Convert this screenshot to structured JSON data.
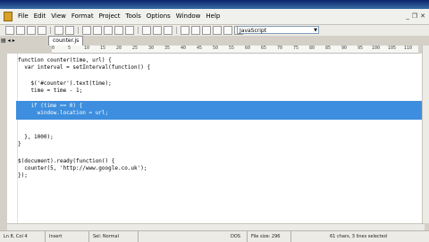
{
  "menu": [
    "File",
    "Edit",
    "View",
    "Format",
    "Project",
    "Tools",
    "Options",
    "Window",
    "Help"
  ],
  "language_select": "JavaScript",
  "tab": {
    "label": "counter.js"
  },
  "ruler_marks": [
    "0",
    "5",
    "10",
    "15",
    "20",
    "25",
    "30",
    "35",
    "40",
    "45",
    "50",
    "55",
    "60",
    "65",
    "70",
    "75",
    "80",
    "85",
    "90",
    "95",
    "100",
    "105",
    "110"
  ],
  "code": [
    "function counter(time, url) {",
    "  var interval = setInterval(function() {",
    "",
    "    $('#counter').text(time);",
    "    time = time - 1;",
    "",
    "    if (time == 0) {",
    "      window.location = url;",
    "",
    "",
    "  }, 1000);",
    "}",
    "",
    "$(document).ready(function() {",
    "  counter(5, 'http://www.google.co.uk');",
    "});"
  ],
  "selected_lines": [
    6,
    7
  ],
  "status": [
    "Ln 8, Col 4",
    "Insert",
    "Sel: Normal",
    "DOS",
    "File size: 296",
    "61 chars, 3 lines selected"
  ]
}
